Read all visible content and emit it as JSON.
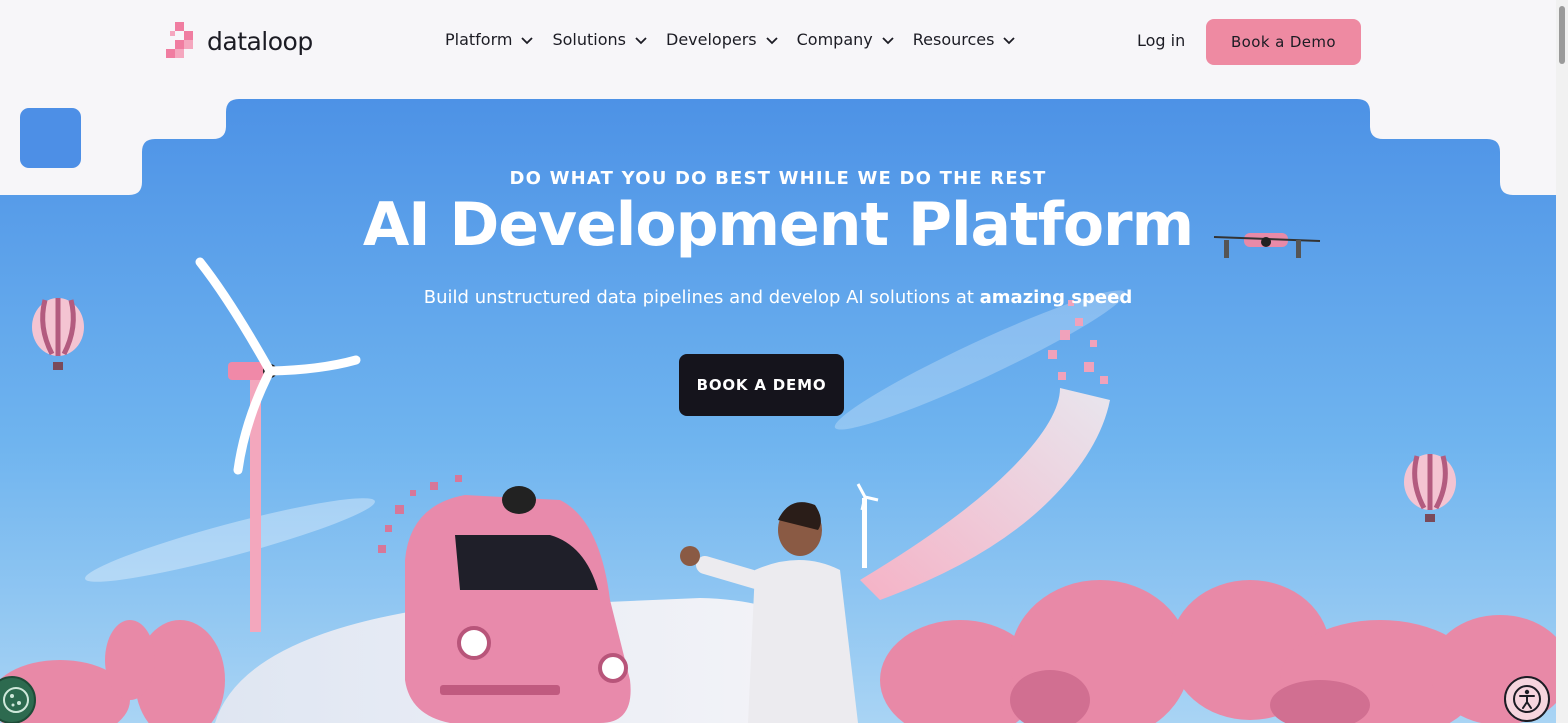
{
  "brand": {
    "name": "dataloop",
    "accent": "#ee8aa2",
    "dark": "#15141c",
    "sky": "#5fa8ec"
  },
  "header": {
    "nav": [
      {
        "label": "Platform",
        "icon": "chevron-down-icon"
      },
      {
        "label": "Solutions",
        "icon": "chevron-down-icon"
      },
      {
        "label": "Developers",
        "icon": "chevron-down-icon"
      },
      {
        "label": "Company",
        "icon": "chevron-down-icon"
      },
      {
        "label": "Resources",
        "icon": "chevron-down-icon"
      }
    ],
    "login_label": "Log in",
    "demo_label": "Book a Demo"
  },
  "hero": {
    "eyebrow": "DO WHAT YOU DO BEST WHILE WE DO THE REST",
    "title": "AI Development Platform",
    "subtitle_prefix": "Build unstructured data pipelines and develop AI solutions at ",
    "subtitle_bold": "amazing speed",
    "cta_label": "BOOK A DEMO"
  },
  "widgets": {
    "cookie_icon": "cookie-icon",
    "accessibility_icon": "accessibility-icon"
  }
}
